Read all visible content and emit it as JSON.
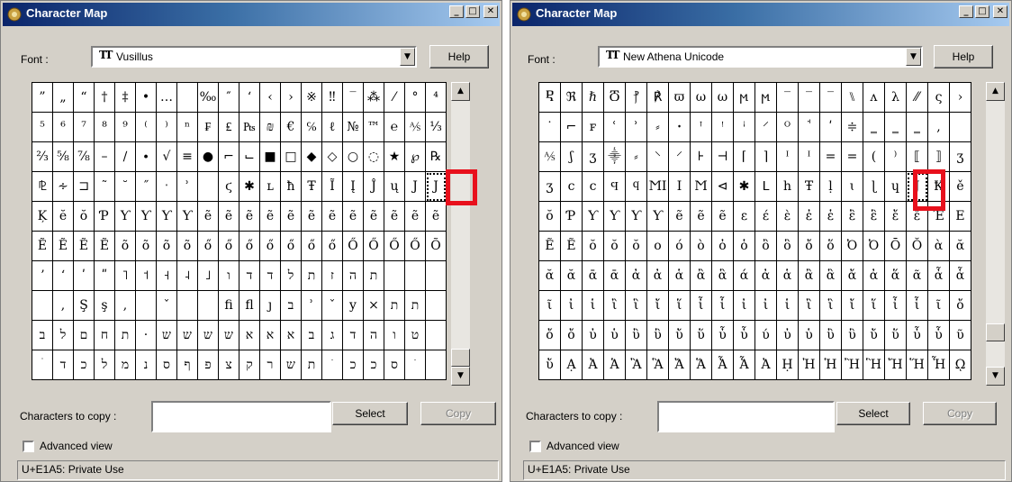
{
  "left": {
    "title": "Character Map",
    "font_label": "Font :",
    "font_name": "Vusillus",
    "help_label": "Help",
    "chars_label": "Characters to copy :",
    "select_label": "Select",
    "copy_label": "Copy",
    "advanced_label": "Advanced view",
    "status": "U+E1A5: Private Use",
    "grid": [
      [
        "”",
        "„",
        "“",
        "†",
        "‡",
        "•",
        "…",
        "",
        "‰",
        "″",
        "‘",
        "‹",
        "›",
        "※",
        "‼",
        "‾",
        "⁂",
        "⁄",
        "°",
        "⁴"
      ],
      [
        "⁵",
        "⁶",
        "⁷",
        "⁸",
        "⁹",
        "⁽",
        "⁾",
        "ⁿ",
        "₣",
        "₤",
        "₧",
        "₪",
        "€",
        "℅",
        "ℓ",
        "№",
        "™",
        "℮",
        "⅍",
        "⅓"
      ],
      [
        "⅔",
        "⅝",
        "⅞",
        "–",
        "∕",
        "∙",
        "√",
        "≡",
        "●",
        "⌐",
        "⌙",
        "■",
        "□",
        "◆",
        "◇",
        "○",
        "◌",
        "★",
        "℘",
        "℞"
      ],
      [
        "⅊",
        "∻",
        "⊐",
        "˜",
        "˘",
        "˝",
        "ˑ",
        "ʾ",
        "",
        "ϛ",
        "✱",
        "ʟ",
        "ħ",
        "Ŧ",
        "Ĩ",
        "Į",
        "Ĵ",
        "ų",
        "J",
        "J"
      ],
      [
        "Ķ",
        "ĕ",
        "ŏ",
        "Ƥ",
        "Ƴ",
        "Ƴ",
        "Ƴ",
        "Ƴ",
        "ẽ",
        "ẽ",
        "ẽ",
        "ẽ",
        "ẽ",
        "ẽ",
        "ẽ",
        "ẽ",
        "ẽ",
        "ẽ",
        "ẽ",
        "ẽ"
      ],
      [
        "Ẽ",
        "Ẽ",
        "Ẽ",
        "Ẽ",
        "õ",
        "õ",
        "õ",
        "õ",
        "ő",
        "ő",
        "ő",
        "ő",
        "ő",
        "ő",
        "ő",
        "Ő",
        "Ő",
        "Ő",
        "Ő",
        "Õ"
      ],
      [
        "ʼ",
        "ʻ",
        "ʹ",
        "ʺ",
        "˥",
        "˦",
        "˧",
        "˨",
        "˩",
        "ו",
        "ד",
        "ד",
        "ל",
        "ת",
        "ז",
        "ה",
        "ת",
        "",
        "",
        ""
      ],
      [
        "",
        ",",
        "Ş",
        "ş",
        ",",
        "",
        "ˇ",
        "",
        "",
        "ﬁ",
        "ﬂ",
        "ȷ",
        "ב",
        "ʾ",
        "ˇ",
        "y",
        "×",
        "ת",
        "ת",
        ""
      ],
      [
        "ב",
        "ל",
        "ם",
        "ח",
        "ת",
        "·",
        "ש",
        "ש",
        "ש",
        "ש",
        "א",
        "א",
        "א",
        "ב",
        "ג",
        "ד",
        "ה",
        "ו",
        "ט",
        ""
      ],
      [
        "ׄ",
        "ד",
        "כ",
        "ל",
        "מ",
        "נ",
        "ס",
        "ף",
        "פ",
        "צ",
        "ק",
        "ר",
        "ש",
        "ת",
        "ׁ",
        "כ",
        "כ",
        "ס",
        "ׂ",
        ""
      ]
    ]
  },
  "right": {
    "title": "Character Map",
    "font_label": "Font :",
    "font_name": "New Athena Unicode",
    "help_label": "Help",
    "chars_label": "Characters to copy :",
    "select_label": "Select",
    "copy_label": "Copy",
    "advanced_label": "Advanced view",
    "status": "U+E1A5: Private Use",
    "grid": [
      [
        "Ⴒ",
        "ℜ",
        "ℏ",
        "Ⴃ",
        "⳨",
        "℟",
        "ϖ",
        "ω",
        "ω",
        "ϻ",
        "ϻ",
        "‾",
        "‾",
        "‾",
        "⑊",
        "ʌ",
        "λ",
        "⁄⁄",
        "ς",
        "›"
      ],
      [
        "˙",
        "⌐",
        "ꜰ",
        "ʿ",
        "ʾ",
        "⸗",
        "ꞏ",
        "ꜛ",
        "ꜝ",
        "ꜞ",
        "⸍",
        "ᴼ",
        "ꜗ",
        "ʹ",
        "≑",
        "‗",
        "‗",
        "‗",
        ",",
        ""
      ],
      [
        "⅍",
        "ʃ",
        "ʒ",
        "⸎",
        "⸗",
        "⸌",
        "⸍",
        "⊦",
        "⊣",
        "⌈",
        "⌉",
        "ᴵ",
        "ᴵ",
        "=",
        "=",
        "(",
        "⁾",
        "⟦",
        "⟧",
        "ʒ"
      ],
      [
        "ʒ",
        "ϲ",
        "ϲ",
        "Ϥ",
        "ϥ",
        "ϺI",
        "I",
        "Ϻ",
        "⊲",
        "✱",
        "ᒪ",
        "h",
        "Ŧ",
        "ḷ",
        "ɩ",
        "ɭ",
        "ɥ",
        "J",
        "Ꝁ",
        "ě"
      ],
      [
        "ŏ",
        "Ƥ",
        "Ƴ",
        "Ƴ",
        "Ƴ",
        "Ƴ",
        "ẽ",
        "ẽ",
        "ẽ",
        "ε",
        "έ",
        "ὲ",
        "ἐ",
        "ἑ",
        "ἒ",
        "ἓ",
        "ἔ",
        "ἕ",
        "Έ",
        "Ε"
      ],
      [
        "Ẽ",
        "Ẽ",
        "ŏ",
        "ŏ",
        "ŏ",
        "ο",
        "ό",
        "ὸ",
        "ὀ",
        "ὁ",
        "ὂ",
        "ὃ",
        "ὄ",
        "ὅ",
        "Ὀ",
        "Ὀ",
        "Ō",
        "Ŏ",
        "ὰ",
        "ᾰ"
      ],
      [
        "ᾰ",
        "ᾰ",
        "ᾱ",
        "ᾱ",
        "ἀ",
        "ἀ",
        "ἁ",
        "ἂ",
        "ἃ",
        "ά",
        "ἀ",
        "ἁ",
        "ἂ",
        "ἃ",
        "ἄ",
        "ἀ",
        "ἅ",
        "ᾶ",
        "ἆ",
        "ἇ"
      ],
      [
        "ῖ",
        "ἰ",
        "ἱ",
        "ἲ",
        "ἳ",
        "ἴ",
        "ἵ",
        "ἶ",
        "ἷ",
        "ἰ",
        "ἰ",
        "ἱ",
        "ἲ",
        "ἳ",
        "ἴ",
        "ἵ",
        "ἶ",
        "ἷ",
        "ῖ",
        "ὄ"
      ],
      [
        "ὄ",
        "ὄ",
        "ὐ",
        "ὑ",
        "ὒ",
        "ὓ",
        "ὔ",
        "ὕ",
        "ὖ",
        "ὗ",
        "ύ",
        "ὐ",
        "ὑ",
        "ὒ",
        "ὓ",
        "ὔ",
        "ὕ",
        "ὖ",
        "ὗ",
        "ῦ"
      ],
      [
        "ὔ",
        "Ạ",
        "Ἀ",
        "Ἁ",
        "Ἂ",
        "Ἃ",
        "Ἄ",
        "Ἅ",
        "Ἆ",
        "Ἇ",
        "Ἀ",
        "Ḥ",
        "Ἠ",
        "Ἡ",
        "Ἢ",
        "Ἣ",
        "Ἤ",
        "Ἥ",
        "Ἦ",
        "ῼ"
      ]
    ]
  },
  "accent": {
    "title_start": "#0a246a",
    "title_end": "#a6caf0",
    "highlight": "#e8101c"
  }
}
